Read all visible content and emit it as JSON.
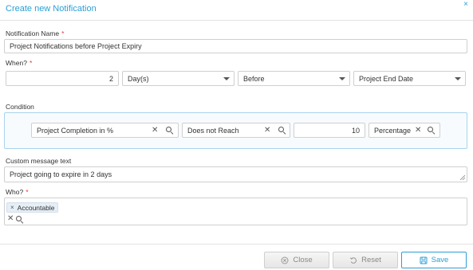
{
  "dialog": {
    "title": "Create new Notification",
    "close_glyph": "×"
  },
  "notification_name": {
    "label": "Notification Name",
    "required_mark": "*",
    "value": "Project Notifications before Project Expiry"
  },
  "when": {
    "label": "When?",
    "required_mark": "*",
    "amount": "2",
    "unit": "Day(s)",
    "relation": "Before",
    "reference": "Project End Date"
  },
  "condition": {
    "label": "Condition",
    "metric": "Project Completion in %",
    "operator": "Does not Reach",
    "value": "10",
    "unit": "Percentage"
  },
  "custom_message": {
    "label": "Custom message text",
    "value": "Project going to expire in 2 days"
  },
  "who": {
    "label": "Who?",
    "required_mark": "*",
    "tags": [
      "Accountable"
    ],
    "tag_remove_glyph": "×",
    "clear_glyph": "✕"
  },
  "buttons": {
    "close": "Close",
    "reset": "Reset",
    "save": "Save"
  },
  "icons": {
    "search": "search-icon",
    "clear": "clear-icon",
    "caret": "chevron-down-icon",
    "close_circle": "close-circle-icon",
    "reset": "reset-icon",
    "save": "save-icon"
  },
  "colors": {
    "accent": "#2a9fd6",
    "required": "#e53935",
    "condition_border": "#a9d3ee"
  }
}
